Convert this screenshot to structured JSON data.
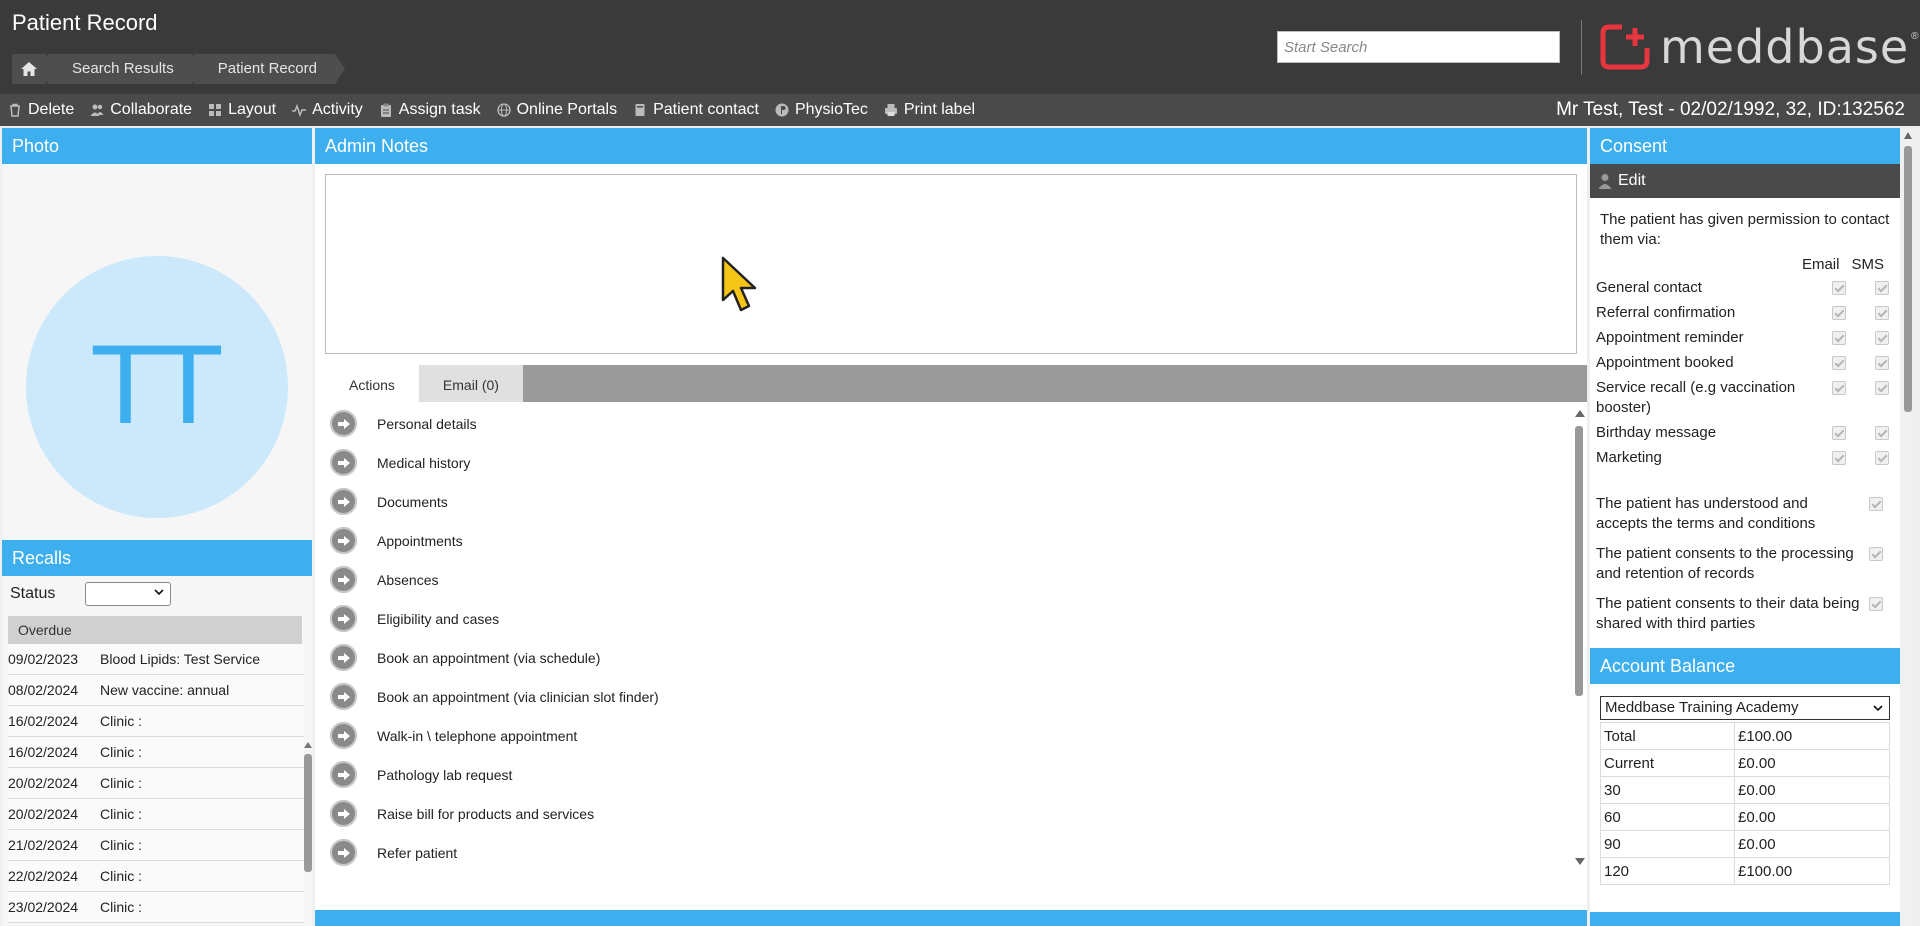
{
  "header": {
    "title": "Patient Record",
    "breadcrumb": [
      "Search Results",
      "Patient Record"
    ],
    "search_placeholder": "Start Search",
    "logo_text": "meddbase",
    "logo_reg": "®"
  },
  "toolbar": {
    "items": [
      {
        "label": "Delete",
        "icon": "trash-icon"
      },
      {
        "label": "Collaborate",
        "icon": "users-icon"
      },
      {
        "label": "Layout",
        "icon": "layout-icon"
      },
      {
        "label": "Activity",
        "icon": "activity-icon"
      },
      {
        "label": "Assign task",
        "icon": "clipboard-icon"
      },
      {
        "label": "Online Portals",
        "icon": "globe-icon"
      },
      {
        "label": "Patient contact",
        "icon": "phone-book-icon"
      },
      {
        "label": "PhysioTec",
        "icon": "physiotec-icon"
      },
      {
        "label": "Print label",
        "icon": "printer-icon"
      }
    ],
    "patient_summary": "Mr Test, Test - 02/02/1992, 32, ID:132562"
  },
  "photo": {
    "heading": "Photo",
    "initials": "TT"
  },
  "recalls": {
    "heading": "Recalls",
    "status_label": "Status",
    "status_value": "",
    "group": "Overdue",
    "rows": [
      {
        "date": "09/02/2023",
        "text": "Blood Lipids: Test Service"
      },
      {
        "date": "08/02/2024",
        "text": "New vaccine: annual"
      },
      {
        "date": "16/02/2024",
        "text": "Clinic :"
      },
      {
        "date": "16/02/2024",
        "text": "Clinic :"
      },
      {
        "date": "20/02/2024",
        "text": "Clinic :"
      },
      {
        "date": "20/02/2024",
        "text": "Clinic :"
      },
      {
        "date": "21/02/2024",
        "text": "Clinic :"
      },
      {
        "date": "22/02/2024",
        "text": "Clinic :"
      },
      {
        "date": "23/02/2024",
        "text": "Clinic :"
      }
    ]
  },
  "admin_notes": {
    "heading": "Admin Notes",
    "value": ""
  },
  "tabs": [
    {
      "label": "Actions",
      "active": true
    },
    {
      "label": "Email (0)",
      "active": false
    }
  ],
  "actions": [
    "Personal details",
    "Medical history",
    "Documents",
    "Appointments",
    "Absences",
    "Eligibility and cases",
    "Book an appointment (via schedule)",
    "Book an appointment (via clinician slot finder)",
    "Walk-in \\ telephone appointment",
    "Pathology lab request",
    "Raise bill for products and services",
    "Refer patient"
  ],
  "consent": {
    "heading": "Consent",
    "edit_label": "Edit",
    "intro": "The patient has given permission to contact them via:",
    "col_email": "Email",
    "col_sms": "SMS",
    "rows": [
      "General contact",
      "Referral confirmation",
      "Appointment reminder",
      "Appointment booked",
      "Service recall (e.g vaccination booster)",
      "Birthday message",
      "Marketing"
    ],
    "terms": [
      "The patient has understood and accepts the terms and conditions",
      "The patient consents to the processing and retention of records",
      "The patient consents to their data being shared with third parties"
    ]
  },
  "account_balance": {
    "heading": "Account Balance",
    "selected": "Meddbase Training Academy",
    "rows": [
      {
        "label": "Total",
        "value": "£100.00"
      },
      {
        "label": "Current",
        "value": "£0.00"
      },
      {
        "label": "30",
        "value": "£0.00"
      },
      {
        "label": "60",
        "value": "£0.00"
      },
      {
        "label": "90",
        "value": "£0.00"
      },
      {
        "label": "120",
        "value": "£100.00"
      }
    ]
  },
  "colors": {
    "accent": "#3daeee",
    "header_bg": "#3a3a3a",
    "logo_red": "#e8363f"
  }
}
